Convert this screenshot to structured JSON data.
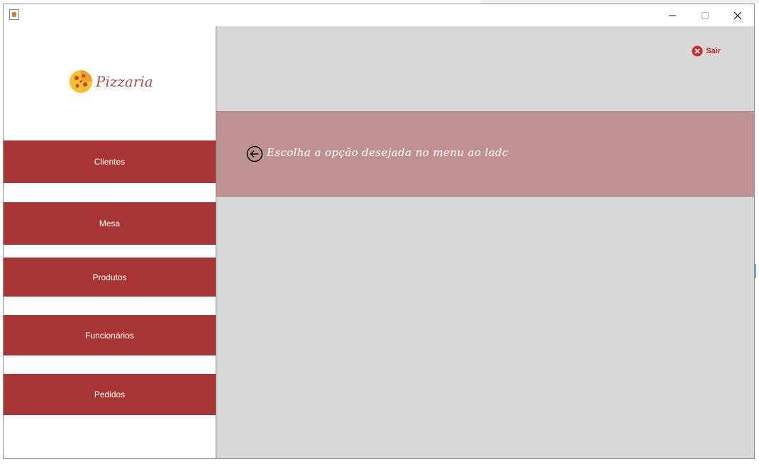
{
  "window": {
    "title": ""
  },
  "titlebar": {
    "minimize_icon": "minimize-icon",
    "maximize_icon": "maximize-icon",
    "close_icon": "close-icon"
  },
  "brand": {
    "name": "Pizzaria",
    "logo_icon": "pizza-icon"
  },
  "menu": {
    "items": [
      {
        "label": "Clientes"
      },
      {
        "label": "Mesa"
      },
      {
        "label": "Produtos"
      },
      {
        "label": "Funcionários"
      },
      {
        "label": "Pedidos"
      }
    ]
  },
  "header": {
    "logout_label": "Sair",
    "logout_icon": "close-circle-icon"
  },
  "banner": {
    "text": "Escolha a opção desejada no menu ao ladc",
    "icon": "arrow-left-circle-icon"
  },
  "colors": {
    "menu_button": "#a83535",
    "banner": "#be9292",
    "content_bg": "#d8d8d8",
    "logout": "#c51f1f"
  }
}
